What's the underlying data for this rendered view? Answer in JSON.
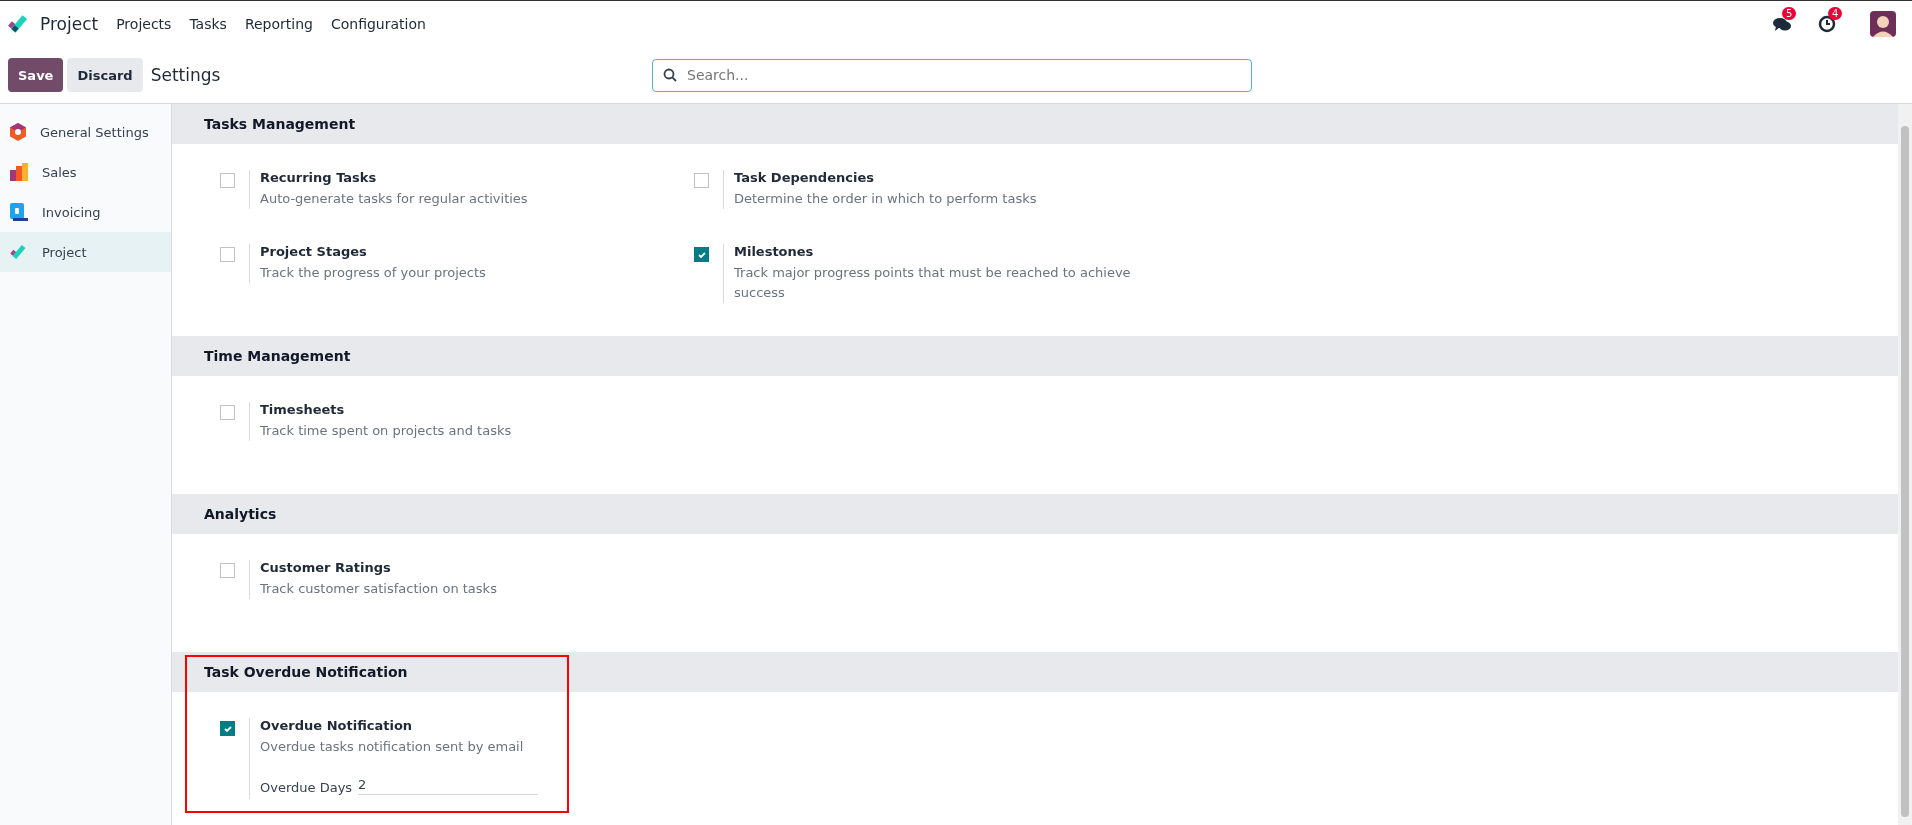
{
  "navbar": {
    "app_name": "Project",
    "menu": [
      "Projects",
      "Tasks",
      "Reporting",
      "Configuration"
    ],
    "messages_badge": "5",
    "activities_badge": "4"
  },
  "control_panel": {
    "buttons": [
      {
        "label": "Save",
        "kind": "primary"
      },
      {
        "label": "Discard",
        "kind": "secondary"
      }
    ],
    "title": "Settings",
    "search": {
      "placeholder": "Search..."
    }
  },
  "sidebar": {
    "items": [
      {
        "label": "General Settings",
        "kind": "general",
        "selected": false
      },
      {
        "label": "Sales",
        "kind": "sales",
        "selected": false
      },
      {
        "label": "Invoicing",
        "kind": "invoicing",
        "selected": false
      },
      {
        "label": "Project",
        "kind": "project",
        "selected": true
      }
    ]
  },
  "sections": [
    {
      "title": "Tasks Management",
      "highlighted": false,
      "settings": [
        {
          "title": "Recurring Tasks",
          "description": "Auto-generate tasks for regular activities",
          "checked": false
        },
        {
          "title": "Task Dependencies",
          "description": "Determine the order in which to perform tasks",
          "checked": false
        },
        {
          "title": "Project Stages",
          "description": "Track the progress of your projects",
          "checked": false
        },
        {
          "title": "Milestones",
          "description": "Track major progress points that must be reached to achieve success",
          "checked": true
        }
      ]
    },
    {
      "title": "Time Management",
      "highlighted": false,
      "settings": [
        {
          "title": "Timesheets",
          "description": "Track time spent on projects and tasks",
          "checked": false
        }
      ]
    },
    {
      "title": "Analytics",
      "highlighted": false,
      "settings": [
        {
          "title": "Customer Ratings",
          "description": "Track customer satisfaction on tasks",
          "checked": false
        }
      ]
    },
    {
      "title": "Task Overdue Notification",
      "highlighted": true,
      "settings": [
        {
          "title": "Overdue Notification",
          "description": "Overdue tasks notification sent by email",
          "checked": true,
          "field": {
            "label": "Overdue Days",
            "value": "2"
          }
        }
      ]
    }
  ]
}
